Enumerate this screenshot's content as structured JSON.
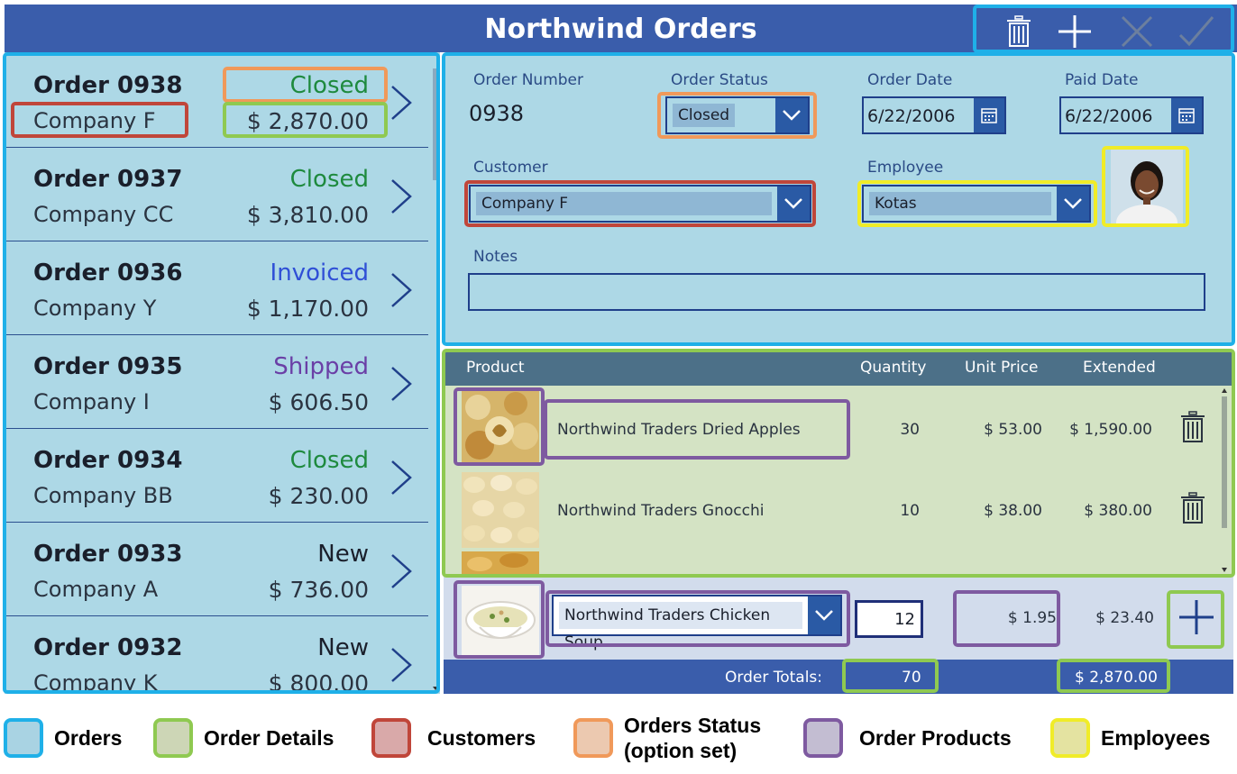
{
  "header": {
    "title": "Northwind Orders"
  },
  "orders": [
    {
      "title": "Order 0938",
      "company": "Company F",
      "status": "Closed",
      "total": "$ 2,870.00",
      "status_color": "#1e8a3e"
    },
    {
      "title": "Order 0937",
      "company": "Company CC",
      "status": "Closed",
      "total": "$ 3,810.00",
      "status_color": "#1e8a3e"
    },
    {
      "title": "Order 0936",
      "company": "Company Y",
      "status": "Invoiced",
      "total": "$ 1,170.00",
      "status_color": "#2f4fd6"
    },
    {
      "title": "Order 0935",
      "company": "Company I",
      "status": "Shipped",
      "total": "$ 606.50",
      "status_color": "#6a3fa6"
    },
    {
      "title": "Order 0934",
      "company": "Company BB",
      "status": "Closed",
      "total": "$ 230.00",
      "status_color": "#1e8a3e"
    },
    {
      "title": "Order 0933",
      "company": "Company A",
      "status": "New",
      "total": "$ 736.00",
      "status_color": "#1a1f2b"
    },
    {
      "title": "Order 0932",
      "company": "Company K",
      "status": "New",
      "total": "$ 800.00",
      "status_color": "#1a1f2b"
    }
  ],
  "form": {
    "order_number_label": "Order Number",
    "order_number": "0938",
    "order_status_label": "Order Status",
    "order_status": "Closed",
    "order_date_label": "Order Date",
    "order_date": "6/22/2006",
    "paid_date_label": "Paid Date",
    "paid_date": "6/22/2006",
    "customer_label": "Customer",
    "customer": "Company F",
    "employee_label": "Employee",
    "employee": "Kotas",
    "notes_label": "Notes",
    "notes": ""
  },
  "details": {
    "headers": {
      "product": "Product",
      "quantity": "Quantity",
      "unit_price": "Unit Price",
      "extended": "Extended"
    },
    "rows": [
      {
        "product": "Northwind Traders Dried Apples",
        "quantity": "30",
        "unit_price": "$ 53.00",
        "extended": "$ 1,590.00"
      },
      {
        "product": "Northwind Traders Gnocchi",
        "quantity": "10",
        "unit_price": "$ 38.00",
        "extended": "$ 380.00"
      }
    ]
  },
  "new_line": {
    "product": "Northwind Traders Chicken Soup",
    "quantity": "12",
    "unit_price": "$ 1.95",
    "extended": "$ 23.40"
  },
  "totals": {
    "label": "Order Totals:",
    "quantity": "70",
    "extended": "$ 2,870.00"
  },
  "legend": [
    {
      "label": "Orders",
      "fill": "#a9d3e3",
      "border": "#1fb0e8"
    },
    {
      "label": "Order Details",
      "fill": "#cdd6b6",
      "border": "#8fc951"
    },
    {
      "label": "Customers",
      "fill": "#d9a9a9",
      "border": "#c0463a"
    },
    {
      "label": "Orders Status\n(option set)",
      "fill": "#ecc9b0",
      "border": "#f0995a"
    },
    {
      "label": "Order Products",
      "fill": "#c3bdd2",
      "border": "#7e5aa0"
    },
    {
      "label": "Employees",
      "fill": "#e4e3a1",
      "border": "#f0ec28"
    }
  ],
  "icons": [
    "trash-icon",
    "add-icon",
    "cancel-icon",
    "check-icon",
    "chevron-right-icon",
    "chevron-down-icon",
    "calendar-icon"
  ]
}
